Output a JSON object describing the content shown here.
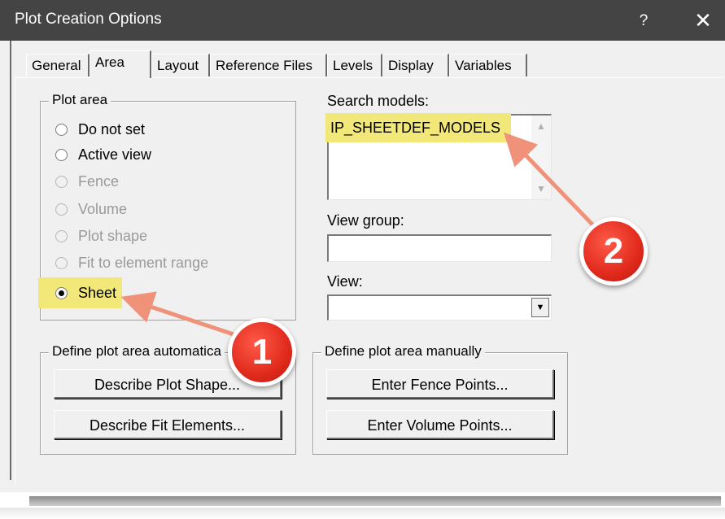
{
  "window": {
    "title": "Plot Creation Options",
    "help": "?",
    "close": "✕"
  },
  "tabs": [
    "General",
    "Area",
    "Layout",
    "Reference Files",
    "Levels",
    "Display",
    "Variables"
  ],
  "plot_area": {
    "legend": "Plot area",
    "options": [
      {
        "label": "Do not set",
        "enabled": true,
        "selected": false
      },
      {
        "label": "Active view",
        "enabled": true,
        "selected": false
      },
      {
        "label": "Fence",
        "enabled": false,
        "selected": false
      },
      {
        "label": "Volume",
        "enabled": false,
        "selected": false
      },
      {
        "label": "Plot shape",
        "enabled": false,
        "selected": false
      },
      {
        "label": "Fit to element range",
        "enabled": false,
        "selected": false
      },
      {
        "label": "Sheet",
        "enabled": true,
        "selected": true
      }
    ]
  },
  "search_models": {
    "label": "Search models:",
    "value": "IP_SHEETDEF_MODELS"
  },
  "view_group": {
    "label": "View group:",
    "value": ""
  },
  "view": {
    "label": "View:",
    "value": ""
  },
  "define_auto": {
    "legend": "Define plot area automatica",
    "buttons": [
      "Describe Plot Shape...",
      "Describe Fit Elements..."
    ]
  },
  "define_manual": {
    "legend": "Define plot area manually",
    "buttons": [
      "Enter Fence Points...",
      "Enter Volume Points..."
    ]
  },
  "callouts": [
    "1",
    "2"
  ],
  "colors": {
    "titlebar": "#444444",
    "highlight": "#f2e87a",
    "callout": "#e02a1c",
    "arrow": "#f0927a"
  }
}
